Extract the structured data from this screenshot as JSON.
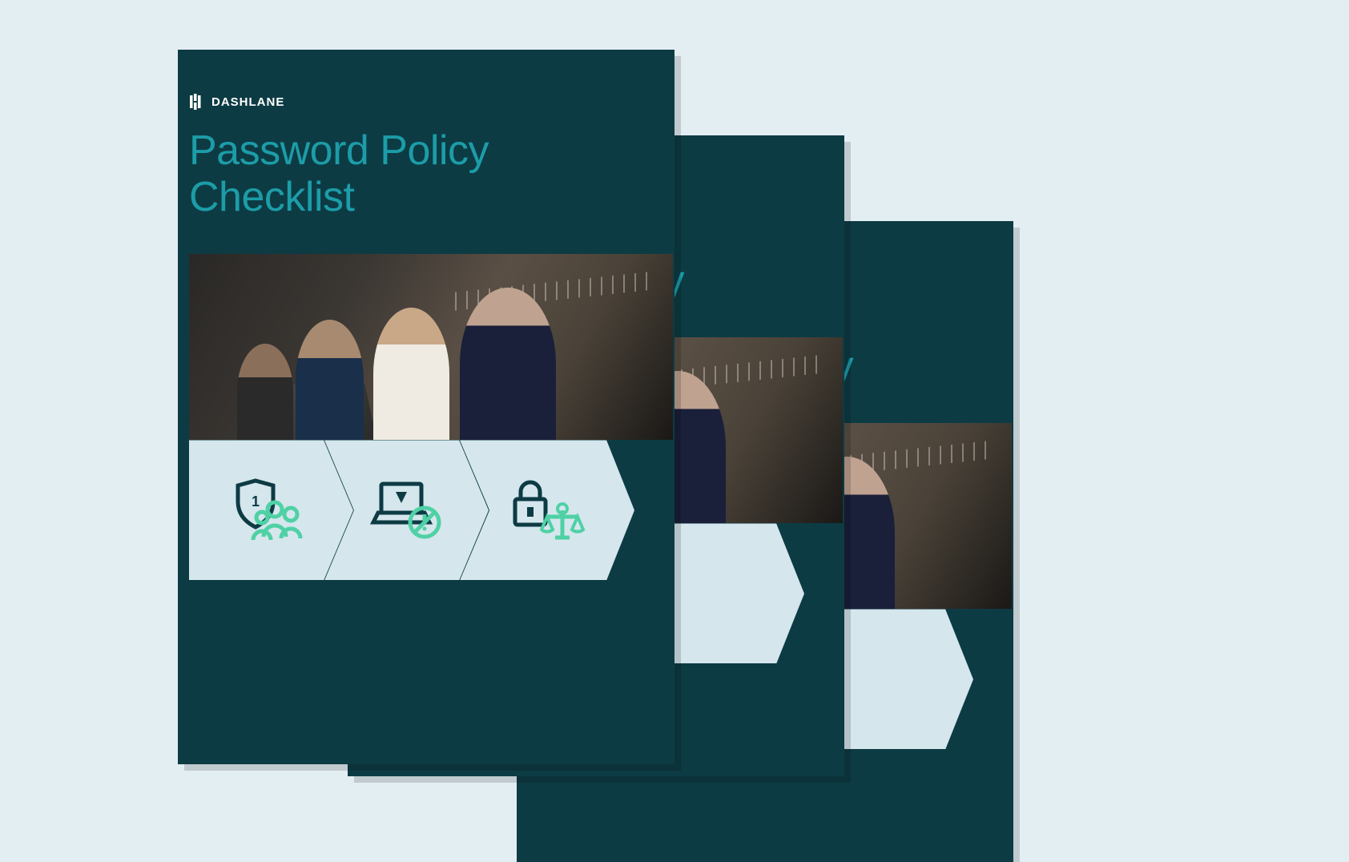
{
  "brand": {
    "name": "DASHLANE"
  },
  "document": {
    "title_line1": "Password Policy",
    "title_line2": "Checklist",
    "title_fragment_back": "cy"
  },
  "chevrons": [
    {
      "icon": "shield-users-icon"
    },
    {
      "icon": "laptop-blocked-icon"
    },
    {
      "icon": "lock-scales-icon"
    }
  ],
  "colors": {
    "background": "#e3eef3",
    "card": "#0d3b44",
    "accent": "#1c9da8",
    "chevron": "#d5e6ed",
    "icon_dark": "#0d3b44",
    "icon_green": "#4fd1a5"
  }
}
